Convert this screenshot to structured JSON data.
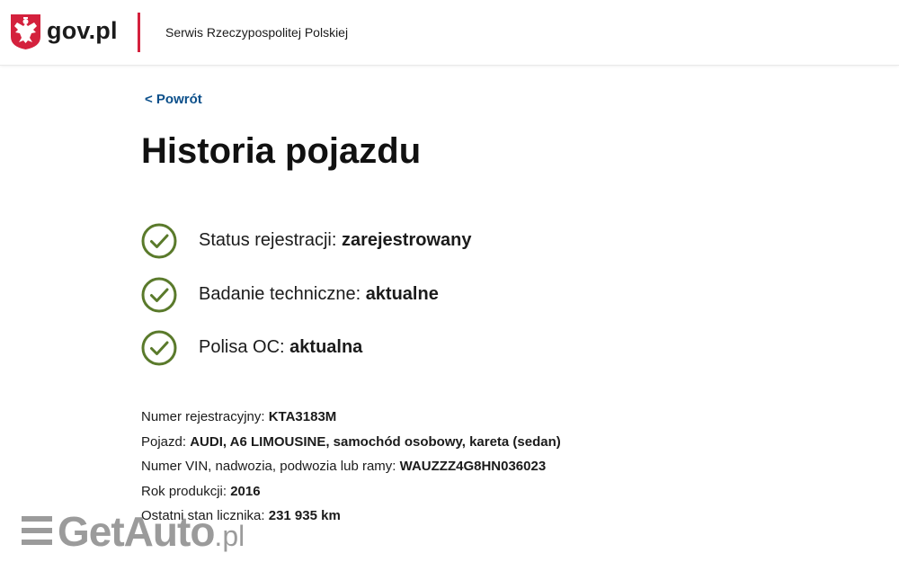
{
  "header": {
    "logo_text": "gov.pl",
    "service_name": "Serwis Rzeczypospolitej Polskiej",
    "divider_color": "#d4213d"
  },
  "nav": {
    "back_label": "< Powrót"
  },
  "page": {
    "title": "Historia pojazdu"
  },
  "statuses": [
    {
      "label": "Status rejestracji: ",
      "value": "zarejestrowany",
      "icon": "check-circle-icon"
    },
    {
      "label": "Badanie techniczne: ",
      "value": "aktualne",
      "icon": "check-circle-icon"
    },
    {
      "label": "Polisa OC: ",
      "value": "aktualna",
      "icon": "check-circle-icon"
    }
  ],
  "details": [
    {
      "label": "Numer rejestracyjny: ",
      "value": "KTA3183M"
    },
    {
      "label": "Pojazd: ",
      "value": "AUDI, A6 LIMOUSINE, samochód osobowy, kareta (sedan)"
    },
    {
      "label": "Numer VIN, nadwozia, podwozia lub ramy: ",
      "value": "WAUZZZ4G8HN036023"
    },
    {
      "label": "Rok produkcji: ",
      "value": "2016"
    },
    {
      "label": "Ostatni stan licznika: ",
      "value": "231 935 km"
    }
  ],
  "watermark": {
    "brand": "GetAuto",
    "suffix": ".pl"
  },
  "colors": {
    "link": "#0b4f8a",
    "check_green": "#5a7a2b",
    "emblem_red": "#d4213d"
  }
}
